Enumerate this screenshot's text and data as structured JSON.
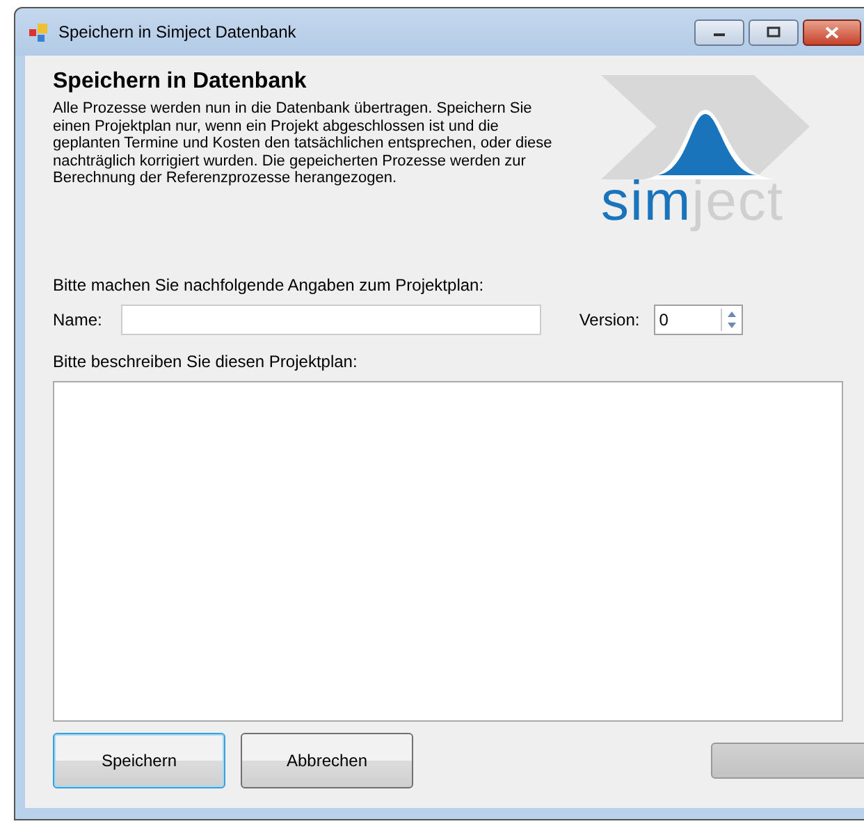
{
  "window": {
    "title": "Speichern in Simject Datenbank"
  },
  "heading": "Speichern in Datenbank",
  "intro": "Alle Prozesse werden nun in die Datenbank übertragen. Speichern Sie einen Projektplan nur, wenn ein Projekt abgeschlossen ist und die geplanten Termine und Kosten den tatsächlichen entsprechen, oder diese nachträglich korrigiert wurden. Die gepeicherten Prozesse werden zur Berechnung der Referenzprozesse herangezogen.",
  "logo": {
    "part_1": "sim",
    "part_2": "ject"
  },
  "prompt": "Bitte machen Sie nachfolgende Angaben zum Projektplan:",
  "name_label": "Name:",
  "version_label": "Version:",
  "version_value": "0",
  "description_label": "Bitte beschreiben Sie diesen Projektplan:",
  "buttons": [
    {
      "label": "Speichern",
      "focused": true
    },
    {
      "label": "Abbrechen",
      "focused": false
    }
  ],
  "progress": {
    "level": 0
  }
}
